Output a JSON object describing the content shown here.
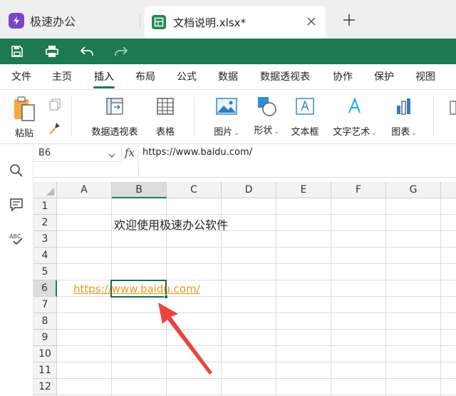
{
  "tabs": {
    "app_label": "极速办公",
    "file_label": "文档说明.xlsx*"
  },
  "menu": [
    "文件",
    "主页",
    "插入",
    "布局",
    "公式",
    "数据",
    "数据透视表",
    "协作",
    "保护",
    "视图"
  ],
  "ribbon": {
    "paste": "粘贴",
    "pivot": "数据透视表",
    "table": "表格",
    "picture": "图片",
    "shape": "形状",
    "textbox": "文本框",
    "wordart": "文字艺术",
    "chart": "图表"
  },
  "formula_bar": {
    "cell_ref": "B6",
    "fx": "fx",
    "value": "https://www.baidu.com/"
  },
  "sheet": {
    "columns": [
      "A",
      "B",
      "C",
      "D",
      "E",
      "F",
      "G"
    ],
    "rows": [
      "1",
      "2",
      "3",
      "4",
      "5",
      "6",
      "7",
      "8",
      "9",
      "10",
      "11",
      "12"
    ],
    "b2_text": "欢迎使用极速办公软件",
    "b6_link": "https://www.baidu.com/",
    "selected_column": "B",
    "selected_row": "6"
  },
  "colors": {
    "accent": "#1e7a4e",
    "link": "#e39a1e",
    "app_logo": "#7b45c9",
    "arrow": "#e8453c"
  }
}
